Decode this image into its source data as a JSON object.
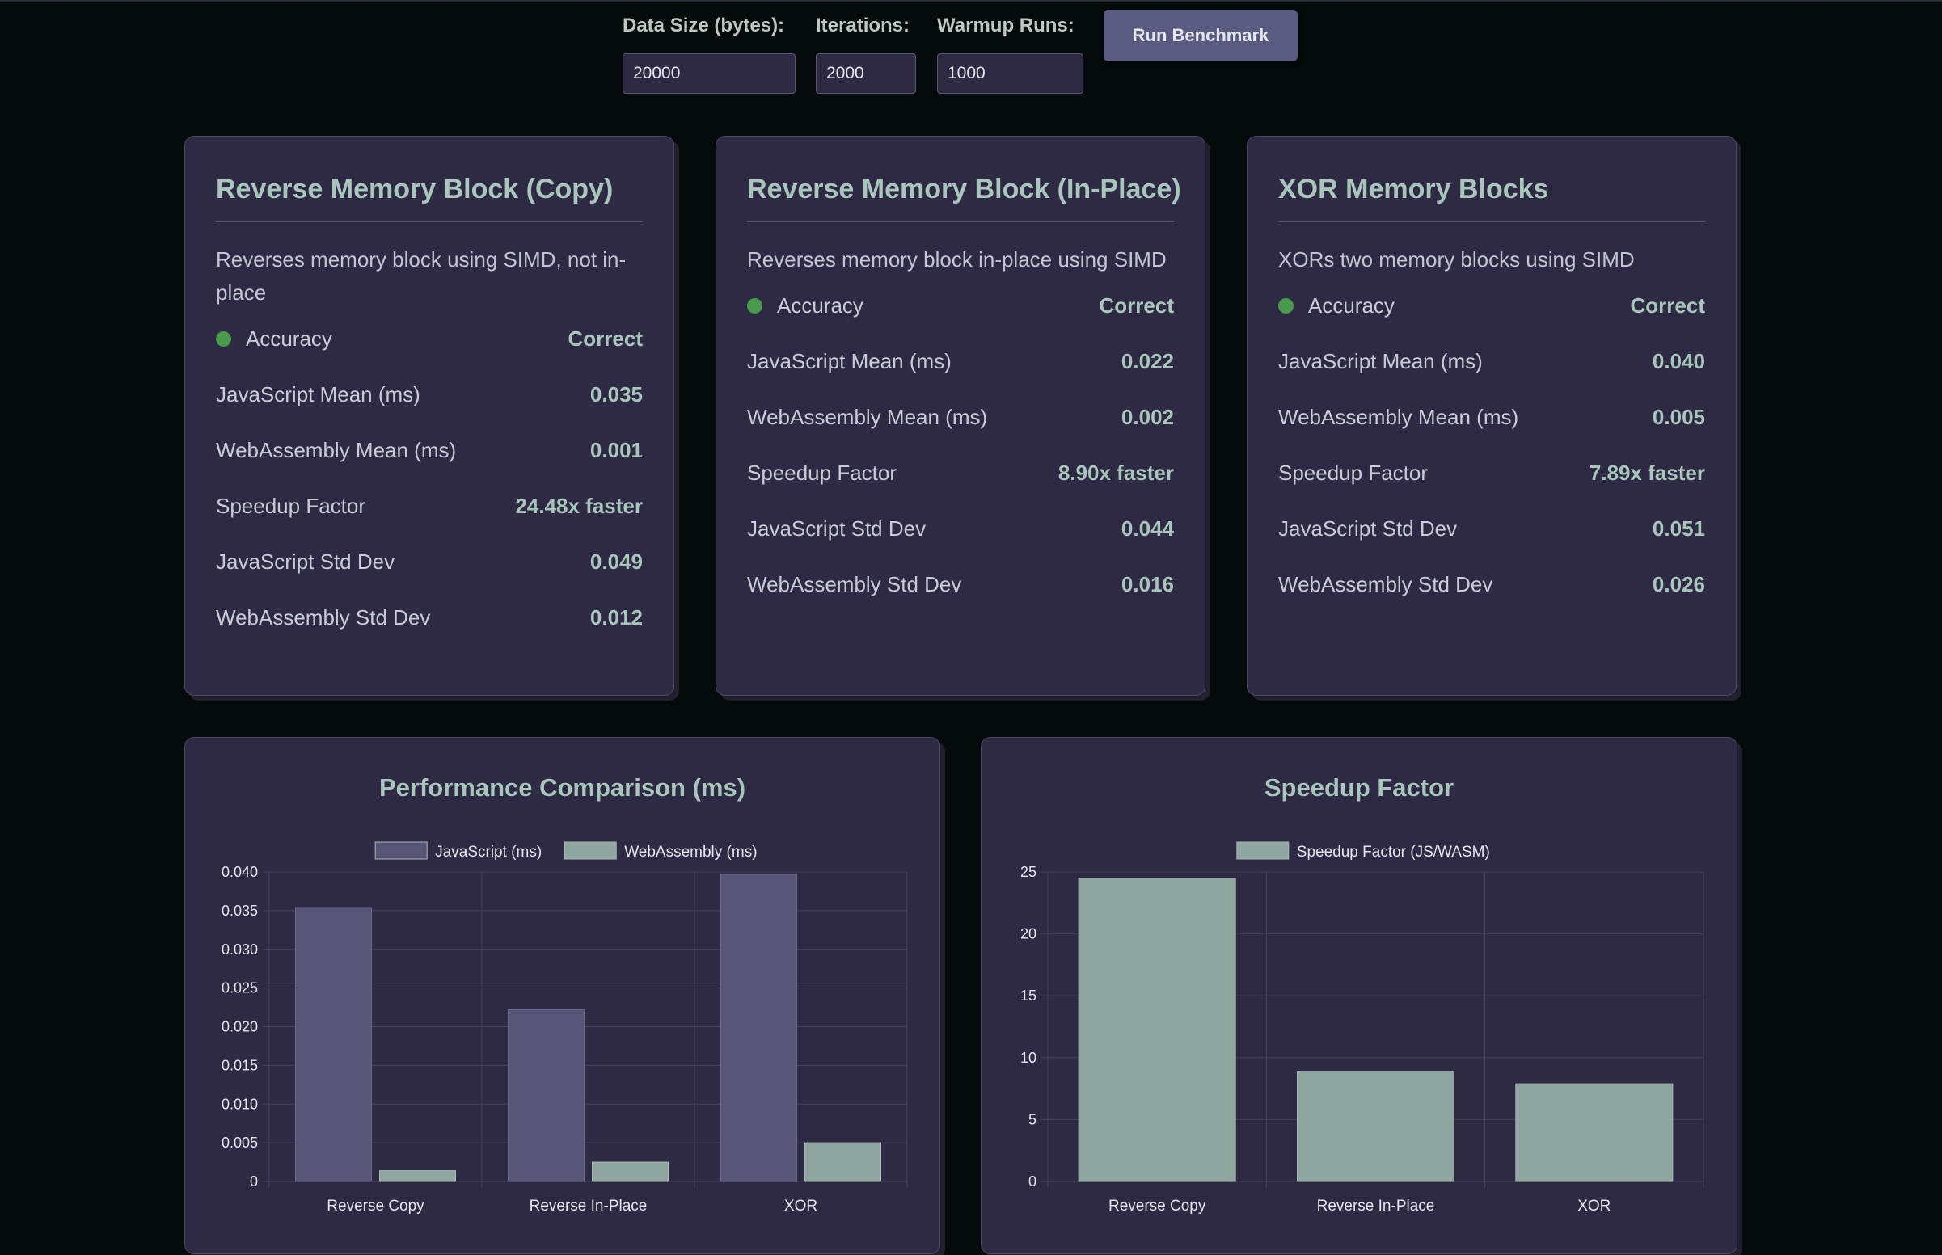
{
  "controls": {
    "data_size_label": "Data Size (bytes):",
    "data_size_value": "20000",
    "iterations_label": "Iterations:",
    "iterations_value": "2000",
    "warmup_label": "Warmup Runs:",
    "warmup_value": "1000",
    "run_button": "Run Benchmark"
  },
  "cards": [
    {
      "title": "Reverse Memory Block (Copy)",
      "description": "Reverses memory block using SIMD, not in-place",
      "accuracy_label": "Accuracy",
      "accuracy_value": "Correct",
      "js_mean_label": "JavaScript Mean (ms)",
      "js_mean": "0.035",
      "wasm_mean_label": "WebAssembly Mean (ms)",
      "wasm_mean": "0.001",
      "speedup_label": "Speedup Factor",
      "speedup": "24.48x faster",
      "js_std_label": "JavaScript Std Dev",
      "js_std": "0.049",
      "wasm_std_label": "WebAssembly Std Dev",
      "wasm_std": "0.012"
    },
    {
      "title": "Reverse Memory Block (In-Place)",
      "description": "Reverses memory block in-place using SIMD",
      "accuracy_label": "Accuracy",
      "accuracy_value": "Correct",
      "js_mean_label": "JavaScript Mean (ms)",
      "js_mean": "0.022",
      "wasm_mean_label": "WebAssembly Mean (ms)",
      "wasm_mean": "0.002",
      "speedup_label": "Speedup Factor",
      "speedup": "8.90x faster",
      "js_std_label": "JavaScript Std Dev",
      "js_std": "0.044",
      "wasm_std_label": "WebAssembly Std Dev",
      "wasm_std": "0.016"
    },
    {
      "title": "XOR Memory Blocks",
      "description": "XORs two memory blocks using SIMD",
      "accuracy_label": "Accuracy",
      "accuracy_value": "Correct",
      "js_mean_label": "JavaScript Mean (ms)",
      "js_mean": "0.040",
      "wasm_mean_label": "WebAssembly Mean (ms)",
      "wasm_mean": "0.005",
      "speedup_label": "Speedup Factor",
      "speedup": "7.89x faster",
      "js_std_label": "JavaScript Std Dev",
      "js_std": "0.051",
      "wasm_std_label": "WebAssembly Std Dev",
      "wasm_std": "0.026"
    }
  ],
  "colors": {
    "accuracy_dot": "#4a9a4e",
    "js_bar": "#585577",
    "wasm_bar": "#8fa5a0",
    "accent_text": "#a9c6bd",
    "card_bg": "#2f2a44",
    "page_bg": "#050a0a"
  },
  "chart_data": [
    {
      "type": "bar",
      "title": "Performance Comparison (ms)",
      "categories": [
        "Reverse Copy",
        "Reverse In-Place",
        "XOR"
      ],
      "series": [
        {
          "name": "JavaScript (ms)",
          "values": [
            0.0354,
            0.0222,
            0.0397
          ]
        },
        {
          "name": "WebAssembly (ms)",
          "values": [
            0.0014,
            0.0025,
            0.005
          ]
        }
      ],
      "ylim": [
        0,
        0.04
      ],
      "yticks": [
        "0",
        "0.005",
        "0.010",
        "0.015",
        "0.020",
        "0.025",
        "0.030",
        "0.035",
        "0.040"
      ],
      "legend": "top",
      "grid": true
    },
    {
      "type": "bar",
      "title": "Speedup Factor",
      "categories": [
        "Reverse Copy",
        "Reverse In-Place",
        "XOR"
      ],
      "series": [
        {
          "name": "Speedup Factor (JS/WASM)",
          "values": [
            24.48,
            8.9,
            7.89
          ]
        }
      ],
      "ylim": [
        0,
        25
      ],
      "yticks": [
        "0",
        "5",
        "10",
        "15",
        "20",
        "25"
      ],
      "legend": "top",
      "grid": true
    }
  ]
}
